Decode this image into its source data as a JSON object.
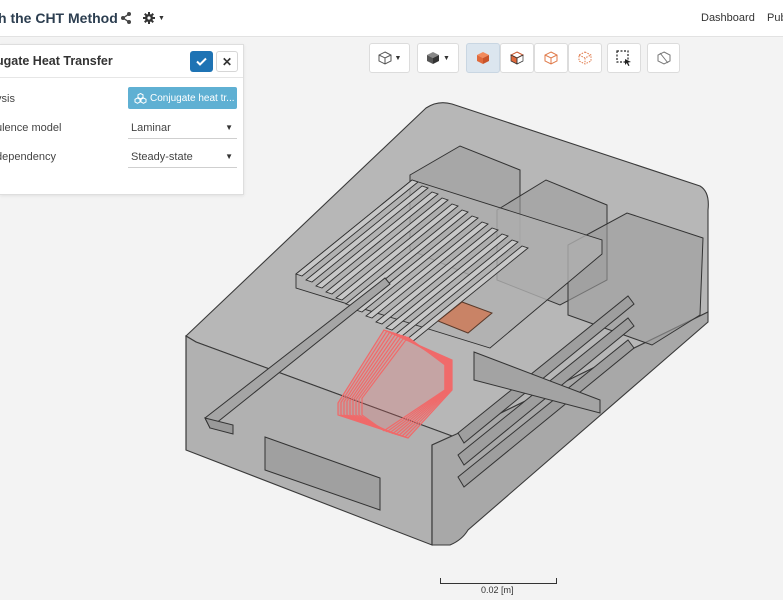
{
  "header": {
    "project_title": "h the CHT Method",
    "share_icon": "share-icon",
    "settings_icon": "gear-icon",
    "nav": {
      "dashboard": "Dashboard",
      "pub": "Pub"
    }
  },
  "toolbar": {
    "buttons": [
      {
        "name": "view-orientation-button",
        "icon": "cube-outline-icon"
      },
      {
        "name": "render-mode-button",
        "icon": "cube-solid-icon"
      },
      {
        "name": "surfaces-button",
        "icon": "cube-orange-icon",
        "active": true
      },
      {
        "name": "surfaces-edges-button",
        "icon": "cube-split-icon"
      },
      {
        "name": "wireframe-button",
        "icon": "cube-wire-icon"
      },
      {
        "name": "points-button",
        "icon": "cube-dots-icon"
      },
      {
        "name": "box-select-button",
        "icon": "box-select-icon"
      },
      {
        "name": "clip-button",
        "icon": "clip-icon"
      }
    ]
  },
  "panel": {
    "title": "ugate Heat Transfer",
    "rows": [
      {
        "label": "ysis",
        "value": "Conjugate heat tr..."
      },
      {
        "label": "ulence model",
        "value": "Laminar"
      },
      {
        "label": "dependency",
        "value": "Steady-state"
      }
    ]
  },
  "colors": {
    "accent": "#1e73b4",
    "analysis_button": "#5fb0d3",
    "highlight_red": "#f06a6a",
    "highlight_brown": "#c98366"
  },
  "scale": {
    "label": "0.02 [m]"
  }
}
